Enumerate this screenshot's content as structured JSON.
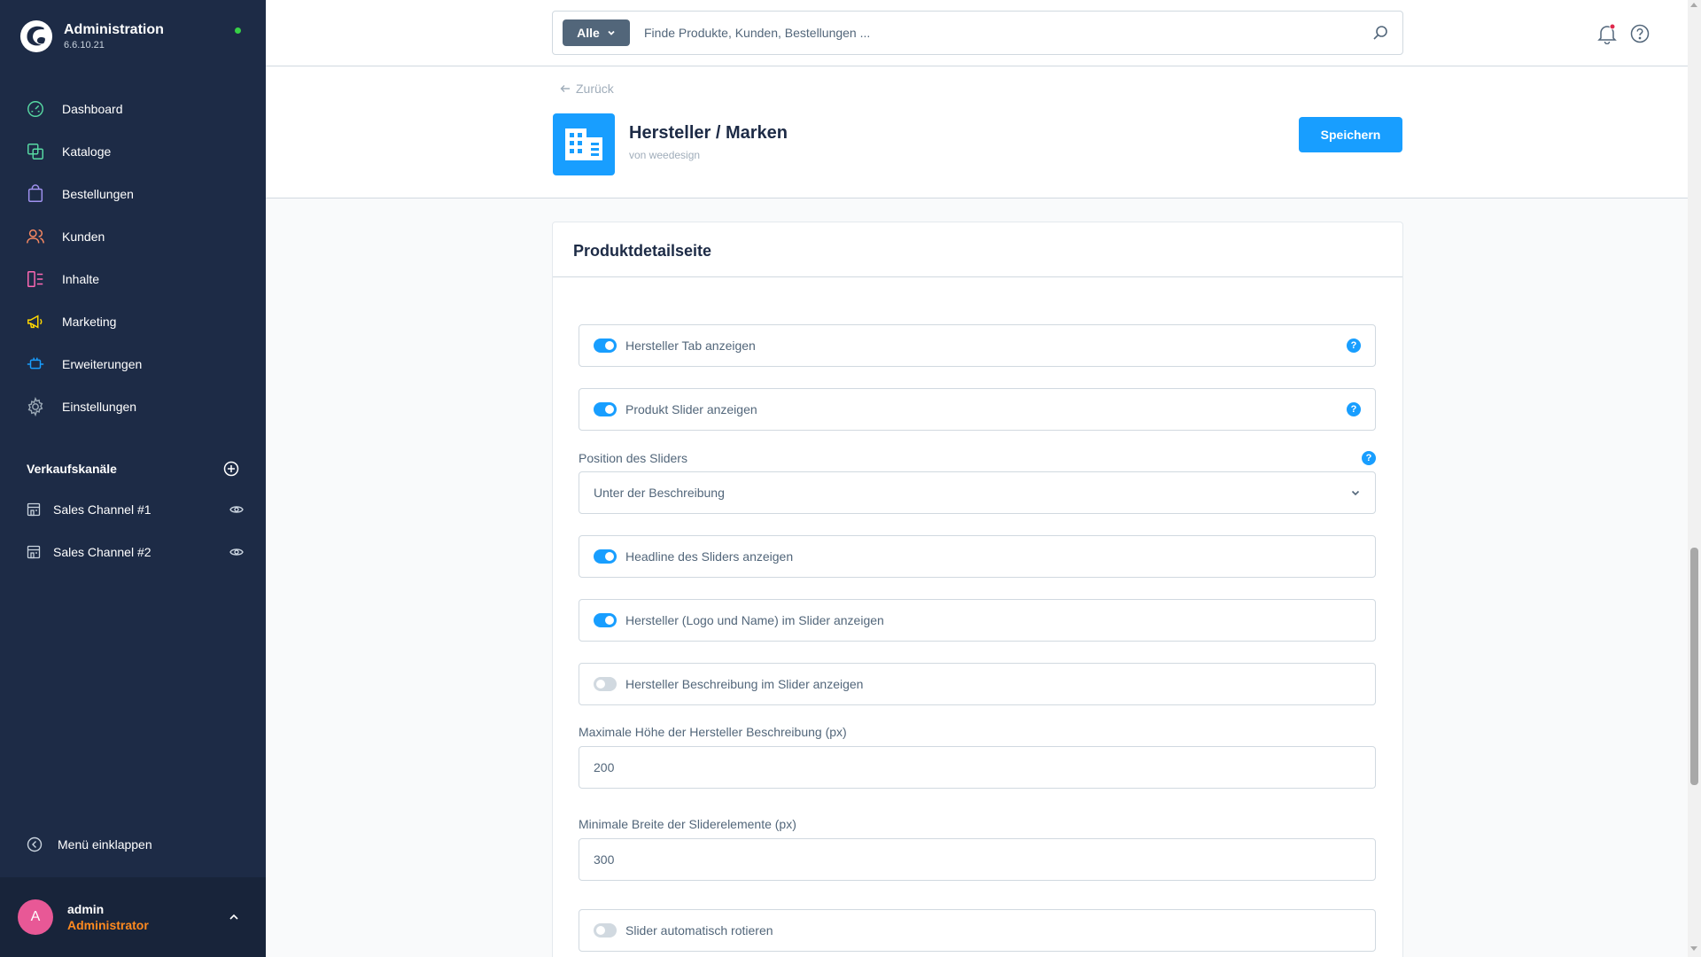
{
  "app": {
    "title": "Administration",
    "version": "6.6.10.21"
  },
  "sidebar": {
    "items": [
      {
        "label": "Dashboard",
        "icon": "dashboard-icon",
        "color": "#57d9a3"
      },
      {
        "label": "Kataloge",
        "icon": "catalog-icon",
        "color": "#57d9a3"
      },
      {
        "label": "Bestellungen",
        "icon": "orders-icon",
        "color": "#a092f0"
      },
      {
        "label": "Kunden",
        "icon": "customers-icon",
        "color": "#f88962"
      },
      {
        "label": "Inhalte",
        "icon": "content-icon",
        "color": "#ff68b4"
      },
      {
        "label": "Marketing",
        "icon": "marketing-icon",
        "color": "#ffd700"
      },
      {
        "label": "Erweiterungen",
        "icon": "extensions-icon",
        "color": "#189eff"
      },
      {
        "label": "Einstellungen",
        "icon": "settings-icon",
        "color": "#9aa8b5"
      }
    ],
    "channels_title": "Verkaufskanäle",
    "channels": [
      {
        "label": "Sales Channel #1"
      },
      {
        "label": "Sales Channel #2"
      }
    ],
    "collapse_label": "Menü einklappen",
    "user": {
      "initial": "A",
      "name": "admin",
      "role": "Administrator"
    }
  },
  "topbar": {
    "search_type": "Alle",
    "search_placeholder": "Finde Produkte, Kunden, Bestellungen ..."
  },
  "header": {
    "back_label": "Zurück",
    "plugin_title": "Hersteller / Marken",
    "plugin_vendor": "von weedesign",
    "save_label": "Speichern"
  },
  "card": {
    "title": "Produktdetailseite",
    "fields": {
      "manufacturer_tab": {
        "label": "Hersteller Tab anzeigen",
        "enabled": true
      },
      "product_slider": {
        "label": "Produkt Slider anzeigen",
        "enabled": true
      },
      "slider_position": {
        "label": "Position des Sliders",
        "value": "Unter der Beschreibung"
      },
      "slider_headline": {
        "label": "Headline des Sliders anzeigen",
        "enabled": true
      },
      "manufacturer_in_slider": {
        "label": "Hersteller (Logo und Name) im Slider anzeigen",
        "enabled": true
      },
      "manufacturer_description": {
        "label": "Hersteller Beschreibung im Slider anzeigen",
        "enabled": false
      },
      "max_height": {
        "label": "Maximale Höhe der Hersteller Beschreibung (px)",
        "value": "200"
      },
      "min_width": {
        "label": "Minimale Breite der Sliderelemente (px)",
        "value": "300"
      },
      "auto_rotate": {
        "label": "Slider automatisch rotieren",
        "enabled": false
      }
    },
    "help_glyph": "?"
  },
  "colors": {
    "sidebar_bg": "#1d2b46",
    "accent": "#189eff",
    "status_online": "#37d046",
    "role": "#ff8a1f",
    "avatar": "#e85896",
    "notification_dot": "#de294c"
  }
}
